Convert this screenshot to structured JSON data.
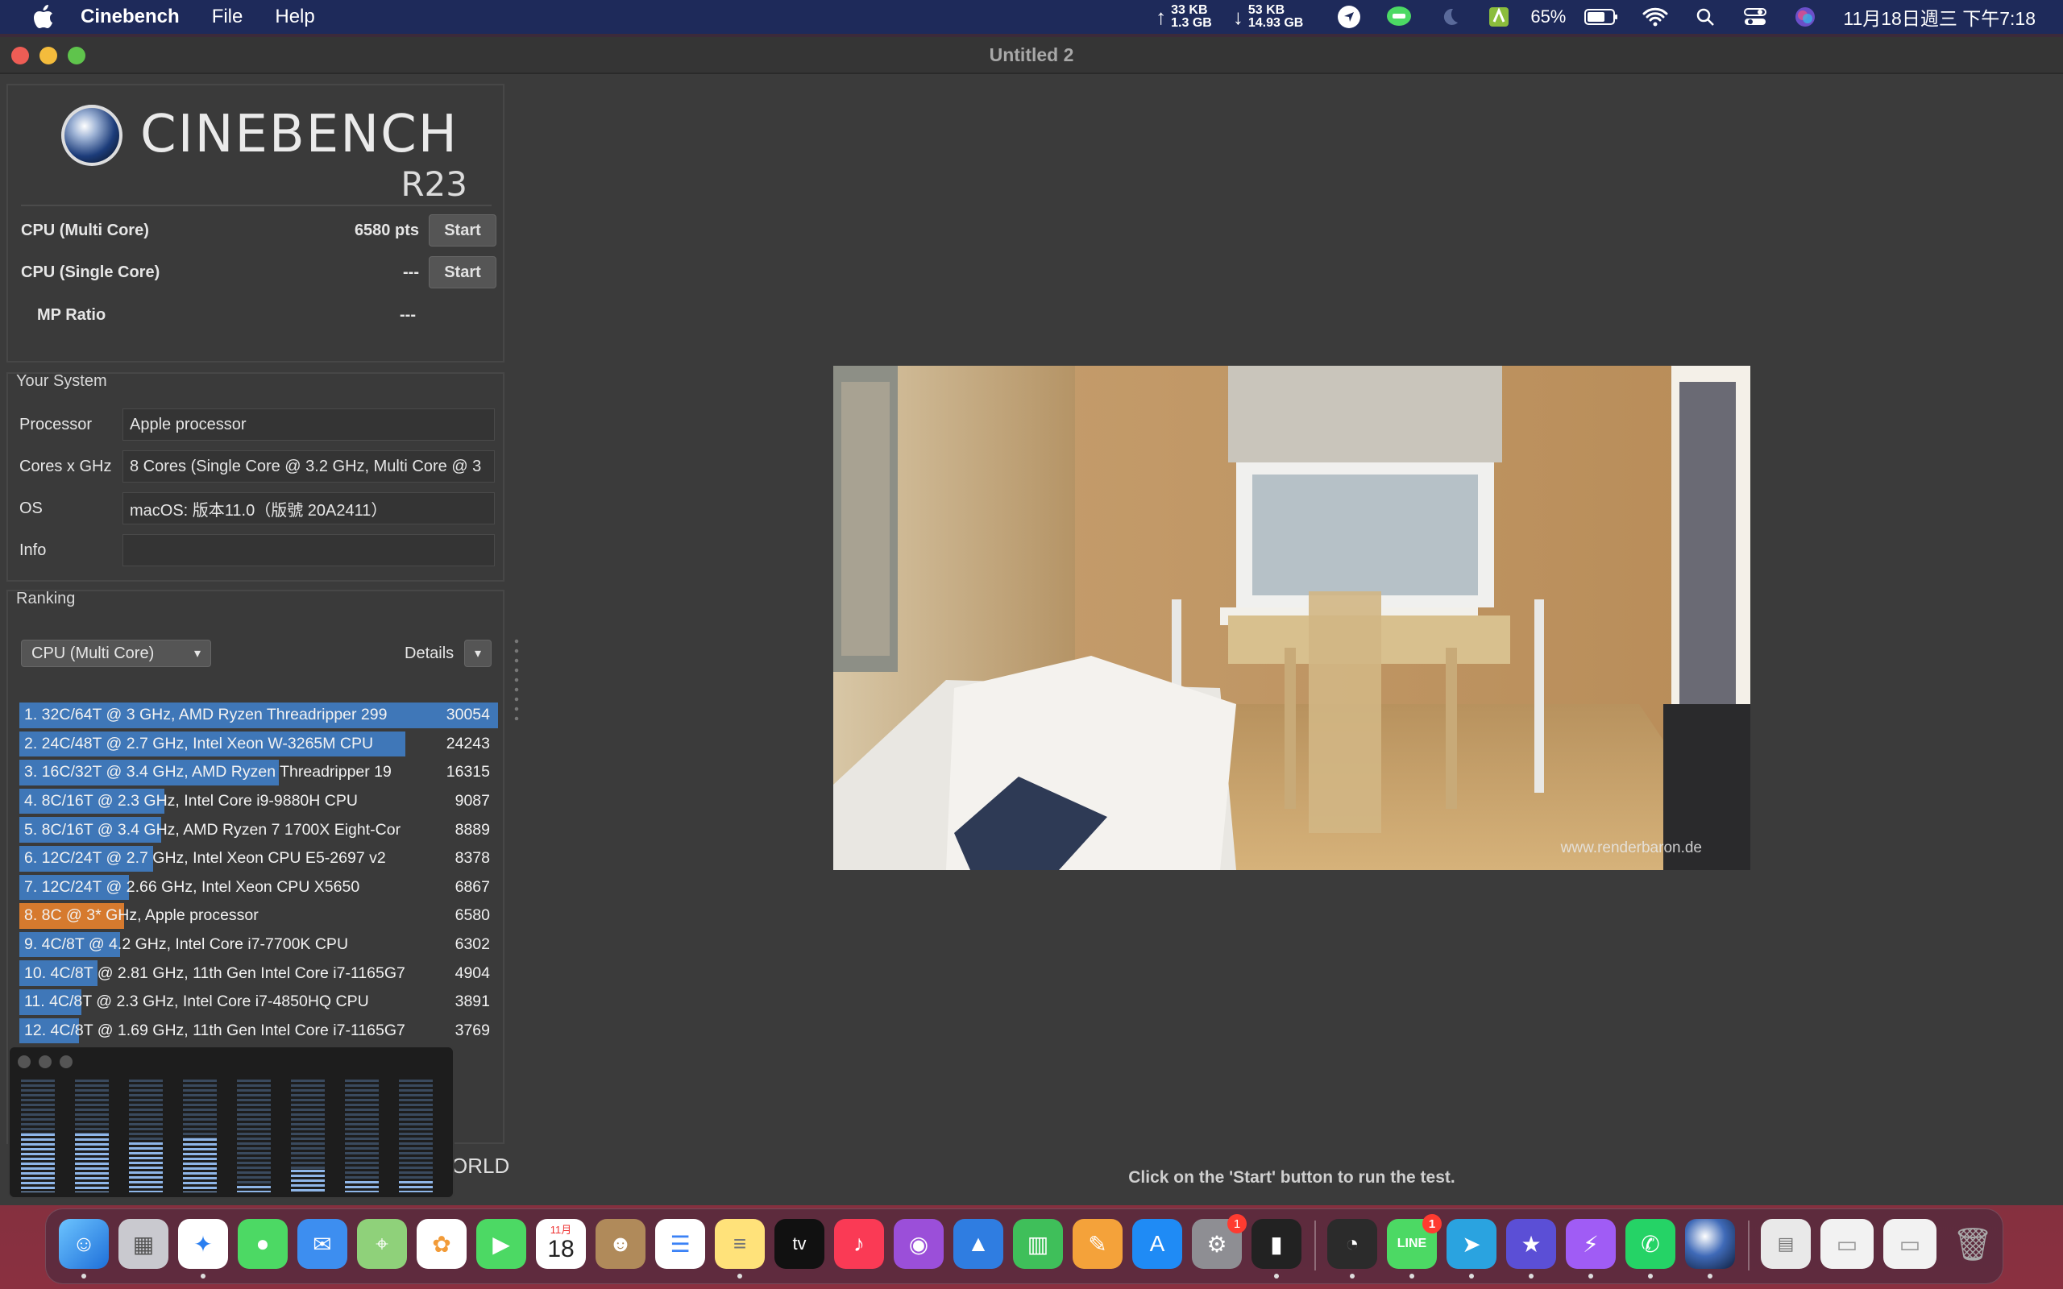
{
  "menubar": {
    "app_name": "Cinebench",
    "menus": [
      "File",
      "Help"
    ],
    "net_up": "33 KB",
    "net_up_total": "1.3 GB",
    "net_down": "53 KB",
    "net_down_total": "14.93 GB",
    "battery": "65%",
    "clock": "11月18日週三 下午7:18"
  },
  "window": {
    "title": "Untitled 2"
  },
  "logo": {
    "name": "CINEBENCH",
    "version": "R23"
  },
  "tests": {
    "multi_label": "CPU (Multi Core)",
    "multi_value": "6580 pts",
    "single_label": "CPU (Single Core)",
    "single_value": "---",
    "mp_label": "MP Ratio",
    "mp_value": "---",
    "start_label": "Start"
  },
  "system": {
    "title": "Your System",
    "processor_label": "Processor",
    "processor_value": "Apple processor",
    "cores_label": "Cores x GHz",
    "cores_value": "8 Cores (Single Core @ 3.2 GHz, Multi Core @ 3",
    "os_label": "OS",
    "os_value": "macOS: 版本11.0（版號 20A2411）",
    "info_label": "Info",
    "info_value": ""
  },
  "ranking": {
    "title": "Ranking",
    "selected": "CPU (Multi Core)",
    "details_label": "Details",
    "max_score": 30054,
    "rows": [
      {
        "label": "1. 32C/64T @ 3 GHz, AMD Ryzen Threadripper 299",
        "score": 30054,
        "mine": false
      },
      {
        "label": "2. 24C/48T @ 2.7 GHz, Intel Xeon W-3265M CPU",
        "score": 24243,
        "mine": false
      },
      {
        "label": "3. 16C/32T @ 3.4 GHz, AMD Ryzen Threadripper 19",
        "score": 16315,
        "mine": false
      },
      {
        "label": "4. 8C/16T @ 2.3 GHz, Intel Core i9-9880H CPU",
        "score": 9087,
        "mine": false
      },
      {
        "label": "5. 8C/16T @ 3.4 GHz, AMD Ryzen 7 1700X Eight-Cor",
        "score": 8889,
        "mine": false
      },
      {
        "label": "6. 12C/24T @ 2.7 GHz, Intel Xeon CPU E5-2697 v2",
        "score": 8378,
        "mine": false
      },
      {
        "label": "7. 12C/24T @ 2.66 GHz, Intel Xeon CPU X5650",
        "score": 6867,
        "mine": false
      },
      {
        "label": "8. 8C @ 3* GHz, Apple processor",
        "score": 6580,
        "mine": true
      },
      {
        "label": "9. 4C/8T @ 4.2 GHz, Intel Core i7-7700K CPU",
        "score": 6302,
        "mine": false
      },
      {
        "label": "10. 4C/8T @ 2.81 GHz, 11th Gen Intel Core i7-1165G7",
        "score": 4904,
        "mine": false
      },
      {
        "label": "11. 4C/8T @ 2.3 GHz, Intel Core i7-4850HQ CPU",
        "score": 3891,
        "mine": false
      },
      {
        "label": "12. 4C/8T @ 1.69 GHz, 11th Gen Intel Core i7-1165G7",
        "score": 3769,
        "mine": false
      }
    ]
  },
  "footer_text": "ORLD",
  "render": {
    "watermark": "www.renderbaron.de"
  },
  "hint": "Click on the 'Start' button to run the test.",
  "cpu_meter": {
    "levels": [
      0.52,
      0.52,
      0.44,
      0.48,
      0.06,
      0.2,
      0.1,
      0.1
    ]
  },
  "dock": {
    "calendar_month": "11月",
    "calendar_day": "18",
    "tv_label": "tv",
    "settings_badge": "1",
    "line_badge": "1",
    "line_label": "LINE"
  }
}
